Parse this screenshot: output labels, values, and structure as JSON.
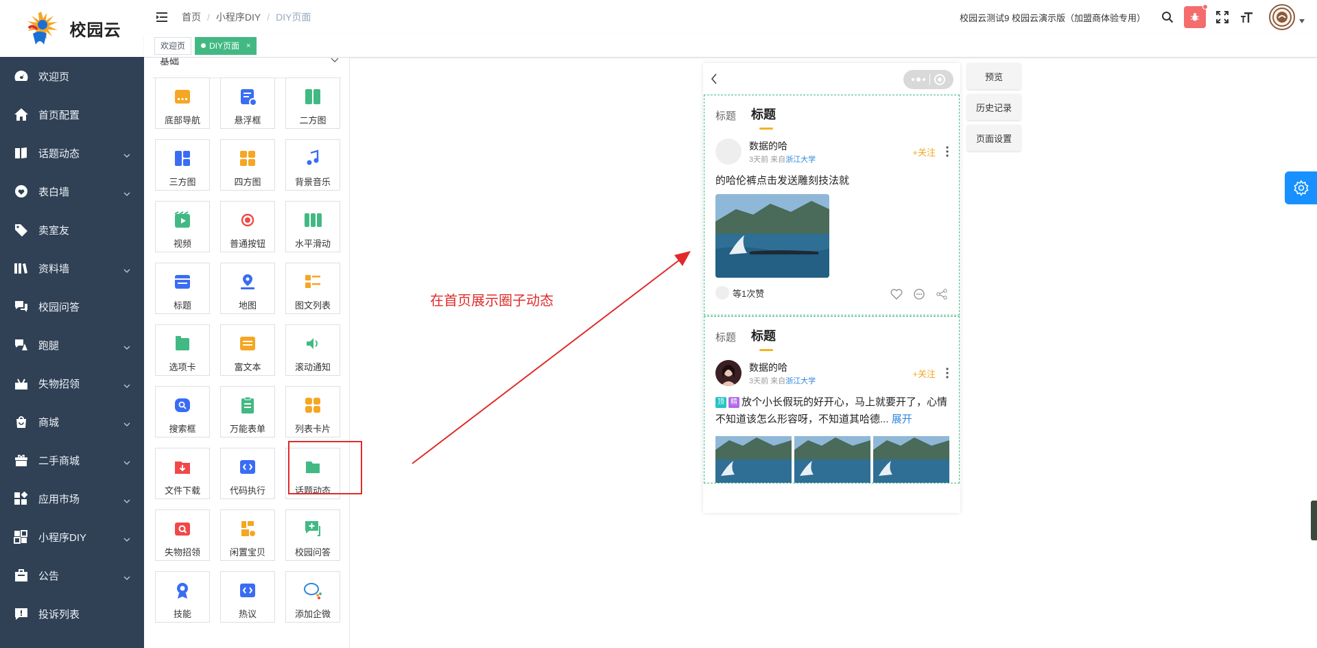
{
  "brand": {
    "name": "校园云",
    "accent": "#42b983",
    "sidebar_bg": "#304156"
  },
  "sidebar": {
    "items": [
      {
        "label": "欢迎页",
        "icon": "dashboard-icon",
        "has_submenu": false
      },
      {
        "label": "首页配置",
        "icon": "home-icon",
        "has_submenu": false
      },
      {
        "label": "话题动态",
        "icon": "book-icon",
        "has_submenu": true
      },
      {
        "label": "表白墙",
        "icon": "heart-icon",
        "has_submenu": true
      },
      {
        "label": "卖室友",
        "icon": "tag-icon",
        "has_submenu": false
      },
      {
        "label": "资料墙",
        "icon": "library-icon",
        "has_submenu": true
      },
      {
        "label": "校园问答",
        "icon": "qa-icon",
        "has_submenu": false
      },
      {
        "label": "跑腿",
        "icon": "errand-icon",
        "has_submenu": true
      },
      {
        "label": "失物招领",
        "icon": "lost-found-icon",
        "has_submenu": true
      },
      {
        "label": "商城",
        "icon": "shop-icon",
        "has_submenu": true
      },
      {
        "label": "二手商城",
        "icon": "gift-icon",
        "has_submenu": true
      },
      {
        "label": "应用市场",
        "icon": "apps-icon",
        "has_submenu": true
      },
      {
        "label": "小程序DIY",
        "icon": "grid-icon",
        "has_submenu": true
      },
      {
        "label": "公告",
        "icon": "notice-icon",
        "has_submenu": true
      },
      {
        "label": "投诉列表",
        "icon": "complaint-icon",
        "has_submenu": false
      }
    ]
  },
  "header": {
    "breadcrumb": [
      "首页",
      "小程序DIY",
      "DIY页面"
    ],
    "store_name": "校园云测试9 校园云演示版（加盟商体验专用）"
  },
  "tags": {
    "home": "欢迎页",
    "active": "DIY页面",
    "close": "×"
  },
  "panel": {
    "group_label": "基础",
    "components": [
      {
        "label": "底部导航",
        "color": "#f5a623",
        "icon": "bottom-nav-icon"
      },
      {
        "label": "悬浮框",
        "color": "#3a6cf4",
        "icon": "float-box-icon"
      },
      {
        "label": "二方图",
        "color": "#42b983",
        "icon": "two-grid-icon"
      },
      {
        "label": "三方图",
        "color": "#3a6cf4",
        "icon": "three-grid-icon"
      },
      {
        "label": "四方图",
        "color": "#f5a623",
        "icon": "four-grid-icon"
      },
      {
        "label": "背景音乐",
        "color": "#3a6cf4",
        "icon": "music-icon"
      },
      {
        "label": "视频",
        "color": "#42b983",
        "icon": "video-icon"
      },
      {
        "label": "普通按钮",
        "color": "#f04848",
        "icon": "button-icon"
      },
      {
        "label": "水平滑动",
        "color": "#42b983",
        "icon": "slider-icon"
      },
      {
        "label": "标题",
        "color": "#3a6cf4",
        "icon": "title-icon"
      },
      {
        "label": "地图",
        "color": "#3a6cf4",
        "icon": "map-pin-icon"
      },
      {
        "label": "图文列表",
        "color": "#f5a623",
        "icon": "image-list-icon"
      },
      {
        "label": "选项卡",
        "color": "#42b983",
        "icon": "tabs-icon"
      },
      {
        "label": "富文本",
        "color": "#f5a623",
        "icon": "rich-text-icon"
      },
      {
        "label": "滚动通知",
        "color": "#42b983",
        "icon": "speaker-icon"
      },
      {
        "label": "搜索框",
        "color": "#3a6cf4",
        "icon": "search-box-icon"
      },
      {
        "label": "万能表单",
        "color": "#42b983",
        "icon": "form-icon"
      },
      {
        "label": "列表卡片",
        "color": "#f5a623",
        "icon": "card-list-icon"
      },
      {
        "label": "文件下载",
        "color": "#f04848",
        "icon": "download-icon"
      },
      {
        "label": "代码执行",
        "color": "#3a6cf4",
        "icon": "code-icon"
      },
      {
        "label": "话题动态",
        "color": "#42b983",
        "icon": "folder-icon"
      },
      {
        "label": "失物招领",
        "color": "#f04848",
        "icon": "lost-icon"
      },
      {
        "label": "闲置宝贝",
        "color": "#f5a623",
        "icon": "idle-icon"
      },
      {
        "label": "校园问答",
        "color": "#42b983",
        "icon": "chat-plus-icon"
      },
      {
        "label": "技能",
        "color": "#3a6cf4",
        "icon": "badge-icon"
      },
      {
        "label": "热议",
        "color": "#3a6cf4",
        "icon": "hot-icon"
      },
      {
        "label": "添加企微",
        "color": "#2e86de",
        "icon": "wecom-icon"
      }
    ]
  },
  "annotation": "在首页展示圈子动态",
  "preview": {
    "post1": {
      "tabs": [
        "标题",
        "标题"
      ],
      "author": "数据的哈",
      "meta_prefix": "3天前 来自",
      "school": "浙江大学",
      "follow": "+关注",
      "text": "的哈伦裤点击发送雕刻技法就",
      "likes": "等1次赞"
    },
    "post2": {
      "tabs": [
        "标题",
        "标题"
      ],
      "author": "数据的哈",
      "meta_prefix": "3天前 来自",
      "school": "浙江大学",
      "follow": "+关注",
      "badge_top": "顶",
      "badge_top_color": "#27c4c4",
      "badge_fine": "精",
      "badge_fine_color": "#b36ae8",
      "text": "放个小长假玩的好开心，马上就要开了，心情不知道该怎么形容呀，不知道其哈德...",
      "expand": "展开"
    }
  },
  "actions": {
    "preview": "预览",
    "history": "历史记录",
    "page_settings": "页面设置"
  }
}
